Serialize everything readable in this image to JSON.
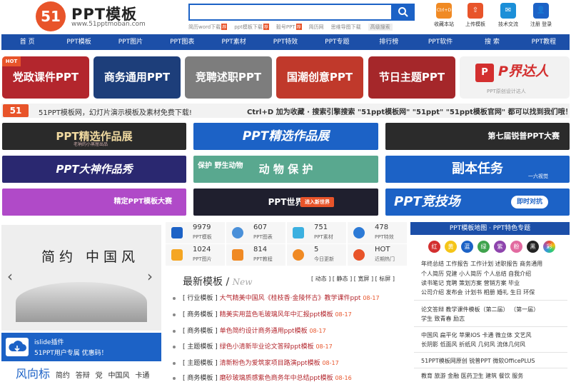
{
  "header": {
    "logo_mark": "51",
    "logo_title": "PPT模板",
    "logo_url": "www.51pptmoban.com",
    "search_placeholder": "",
    "hot_words": [
      {
        "text": "简历word下载",
        "tag": "荐"
      },
      {
        "text": "ppt模板下载",
        "tag": "荐"
      },
      {
        "text": "毅号PPT",
        "tag": "荐"
      },
      {
        "text": "简历网",
        "tag": ""
      },
      {
        "text": "思维导图下载",
        "tag": ""
      },
      {
        "text": "高级搜索",
        "tag": ""
      }
    ],
    "top_icons": [
      {
        "label": "收藏本站",
        "color": "#f08a24",
        "glyph": "Ctrl+D"
      },
      {
        "label": "上传模板",
        "color": "#e8542a",
        "glyph": "⇧"
      },
      {
        "label": "技术交流",
        "color": "#1c8fd8",
        "glyph": "✉"
      },
      {
        "label": "注册 登录",
        "color": "#1c62c6",
        "glyph": "👤"
      }
    ]
  },
  "nav": [
    "首 页",
    "PPT模板",
    "PPT图片",
    "PPT图表",
    "PPT素材",
    "PPT特效",
    "PPT专题",
    "排行榜",
    "PPT软件",
    "搜 索",
    "PPT教程"
  ],
  "categories": [
    {
      "label": "党政课件PPT",
      "color": "#b3262d",
      "badge": "HOT"
    },
    {
      "label": "商务通用PPT",
      "color": "#1d3e7a"
    },
    {
      "label": "竞聘述职PPT",
      "color": "#7d7d7d"
    },
    {
      "label": "国潮创意PPT",
      "color": "#c0392b"
    },
    {
      "label": "节日主题PPT",
      "color": "#a5272a"
    },
    {
      "label": "P界达人",
      "color": "#f2f2f2",
      "sub": "PPT原创设计达人"
    }
  ],
  "notice": {
    "logo": "51",
    "text": "51PPT模板网，幻灯片演示模板及素材免费下载!",
    "right": "Ctrl+D 加为收藏 · 搜索引擎搜索 \"51ppt模板网\" \"51ppt\" \"51ppt模板官网\" 都可以找到我们哦！"
  },
  "banners": [
    {
      "label": "PPT精选作品展",
      "sub": "老衲的小蒸屉出品",
      "color": "#2a2a2a"
    },
    {
      "label": "PPT精选作品展",
      "color": "#1c62c6"
    },
    {
      "label": "第七届锐普PPT大赛",
      "color": "#2b2b2b"
    },
    {
      "label": "PPT大神作品秀",
      "color": "#2a2870"
    },
    {
      "label": "动 物 保 护",
      "sub": "保护 野生动物",
      "color": "#59a88f"
    },
    {
      "label": "副本任务",
      "sub": "一六视觉",
      "color": "#1c62c6"
    },
    {
      "label": "精定PPT模板大赛",
      "color": "#b04ac8"
    },
    {
      "label": "PPT世界",
      "sub": "进入新世界",
      "color": "#1f1f2e"
    },
    {
      "label": "PPT竞技场",
      "sub": "即时对抗",
      "color": "#1c62c6"
    }
  ],
  "slider": {
    "title": "简约 中国风"
  },
  "islide": {
    "name": "islide插件",
    "sub": "51PPT用户专属 优惠码！"
  },
  "fengxiang": {
    "title": "风向标",
    "items": [
      "简约",
      "答辩",
      "党",
      "中国风",
      "卡通"
    ]
  },
  "stats": [
    {
      "value": "9979",
      "label": "PPT模板",
      "color": "#1c62c6"
    },
    {
      "value": "607",
      "label": "PPT图表",
      "color": "#4a90d9"
    },
    {
      "value": "751",
      "label": "PPT素材",
      "color": "#3bb0e0"
    },
    {
      "value": "478",
      "label": "PPT特效",
      "color": "#2c7ad6"
    },
    {
      "value": "1024",
      "label": "PPT图片",
      "color": "#f5a623"
    },
    {
      "value": "814",
      "label": "PPT教程",
      "color": "#f08a24"
    },
    {
      "value": "5",
      "label": "今日更新",
      "color": "#f08a24"
    },
    {
      "value": "HOT",
      "label": "近期热门",
      "color": "#e8542a"
    }
  ],
  "latest": {
    "title": "最新模板",
    "title_en": "New",
    "filters": "[ 动态 ] [ 静态 ] [ 宽屏 ] [ 标屏 ]",
    "items": [
      {
        "category": "[ 行业模板 ]",
        "title": "大气精美中国风《桂枝香·金陵怀古》教学课件ppt",
        "date": "08-17"
      },
      {
        "category": "[ 商务模板 ]",
        "title": "精美实用蓝色毛玻璃风年中汇报ppt模板",
        "date": "08-17"
      },
      {
        "category": "[ 商务模板 ]",
        "title": "单色简约设计商务通用ppt模板",
        "date": "08-17"
      },
      {
        "category": "[ 主题模板 ]",
        "title": "绿色小清新毕业论文答辩ppt模板",
        "date": "08-17"
      },
      {
        "category": "[ 主题模板 ]",
        "title": "清新粉色为爱筑家项目路演ppt模板",
        "date": "08-17"
      },
      {
        "category": "[ 商务模板 ]",
        "title": "磨砂玻璃质感紫色商务年中总结ppt模板",
        "date": "08-16"
      }
    ]
  },
  "map": {
    "title": "PPT模板地图 · PPT特色专题",
    "colors": [
      {
        "label": "红",
        "color": "#d32f2f"
      },
      {
        "label": "黄",
        "color": "#f5c518"
      },
      {
        "label": "蓝",
        "color": "#1c62c6"
      },
      {
        "label": "绿",
        "color": "#3fa34d"
      },
      {
        "label": "紫",
        "color": "#8e44ad"
      },
      {
        "label": "粉",
        "color": "#e26aa0"
      },
      {
        "label": "黑",
        "color": "#222222"
      },
      {
        "label": "彩",
        "color": "#e67e22"
      }
    ],
    "lines": [
      "年终总结  工作报告  工作计划  述职报告  商务通用",
      "个人简历  党建  小人简历  个人总结  自我介绍",
      "读书笔记  竞聘  策划方案  营销方案  毕业",
      "公司介绍  发布会  计划书  相册  婚礼  生日  环保",
      "论文答辩  教学课件模板（第二届）  （第一届）",
      "学生  致青春  励志",
      "中国风  扁平化  苹果IOS  卡通  微立体  文艺风",
      "长阴影  低面风  折纸风  几何风  流体几何风",
      "51PPT模板网原创  锐普PPT  微软OfficePLUS",
      "教育  旅游  金融  医药卫生  建筑  餐饮  服务"
    ]
  }
}
